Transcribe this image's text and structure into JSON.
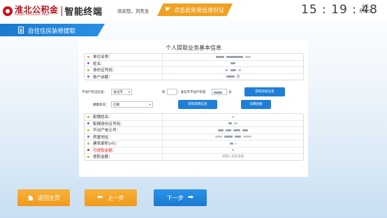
{
  "header": {
    "logo_cn": "淮北公积金",
    "logo_en": "HUAIBEI PROVIDENT FUND",
    "app_title": "智能终端",
    "welcome": "欢迎您，刘先生",
    "logout_label": "点击此处退出身份证",
    "clock": "15 : 19 : 48",
    "date": "8-5",
    "weekday": "星期三"
  },
  "banner": {
    "label": "自住住房装修提取"
  },
  "card": {
    "title": "个人提取业务基本信息",
    "info_rows": [
      {
        "label": "单位名称：",
        "dot": "#f0a022"
      },
      {
        "label": "姓名：",
        "dot": "#8a4fd6"
      },
      {
        "label": "身份证号码：",
        "dot": "#f0a022"
      },
      {
        "label": "账户余额：",
        "dot": "#8a4fd6",
        "suffix": "元"
      }
    ],
    "property_label": "不动产权证信息：",
    "city_select": "淮北市",
    "property_prefix": "皖（",
    "property_mid": "）淮北市不动产权第",
    "property_suffix": "号",
    "get_property_button": "获取房屋信息",
    "marital_label": "婚姻状况：",
    "marital_select": "已婚",
    "spouse_button": "获取配偶信息",
    "calc_button": "试算金额",
    "detail_rows": [
      {
        "label": "配偶姓名：",
        "dot": "#f0a022"
      },
      {
        "label": "配偶身份证号码：",
        "dot": "#8a4fd6"
      },
      {
        "label": "不动产单元号：",
        "dot": "#f0a022"
      },
      {
        "label": "房屋地址：",
        "dot": "#8a4fd6"
      },
      {
        "label": "建筑面积(㎡)：",
        "dot": "#f0a022"
      },
      {
        "label": "可提取金额：",
        "dot": "#e02020",
        "red": true
      },
      {
        "label": "提取金额：",
        "dot": "#f0a022"
      }
    ],
    "withdraw_placeholder": "请输入提取金额"
  },
  "nav": {
    "home": "返回主页",
    "prev": "上一步",
    "next": "下一步"
  },
  "colors": {
    "accent_blue": "#1f7fd6",
    "accent_orange": "#f0a022",
    "brand_red": "#b5121b"
  }
}
